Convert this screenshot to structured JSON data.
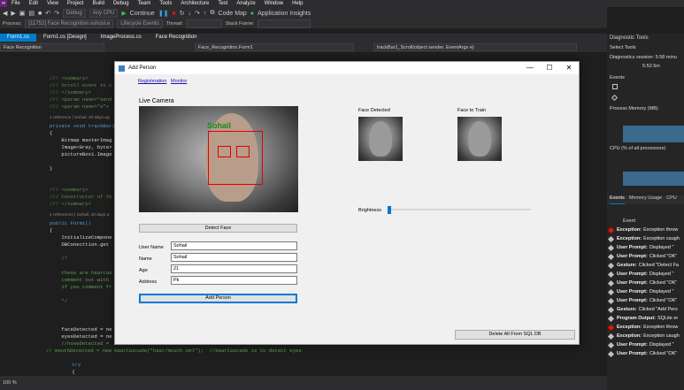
{
  "menu": {
    "items": [
      "File",
      "Edit",
      "View",
      "Project",
      "Build",
      "Debug",
      "Team",
      "Tools",
      "Architecture",
      "Test",
      "Analyze",
      "Window",
      "Help"
    ]
  },
  "toolbar": {
    "config": "Debug",
    "platform": "Any CPU",
    "continue": "Continue",
    "codemap": "Code Map",
    "insights": "Application Insights"
  },
  "debugbar": {
    "process_label": "Process:",
    "process": "[11752] Face Recognition.vshost.e",
    "lifecycle": "Lifecycle Events",
    "thread_label": "Thread:",
    "stack_label": "Stack Frame:"
  },
  "tabs": [
    {
      "label": "Form1.cs"
    },
    {
      "label": "Form1.cs [Design]"
    },
    {
      "label": "ImageProcess.cs"
    },
    {
      "label": "Face Recognition"
    }
  ],
  "navbar": {
    "project": "Face Recognition",
    "class": "Face_Recognition.Form1",
    "member": "trackBar1_Scroll(object sender, EventArgs e)"
  },
  "code": {
    "l1": "/// <summary>",
    "l2": "/// Scroll event to c",
    "l3": "/// </summary>",
    "l4": "/// <param name=\"send",
    "l5": "/// <param name=\"e\">",
    "ref1": "1 reference | Sohail, 40 days ag",
    "l6": "private void trackBar1",
    "l7": "{",
    "l8": "    Bitmap masterImag",
    "l9": "    Image<Gray, byte>",
    "l10": "    pictureBox1.Image",
    "l11": "}",
    "l12": "/// <summary>",
    "l13": "/// Constructor of th",
    "l14": "/// </summary>",
    "ref2": "2 references | Sohail, 40 days a",
    "l15": "public Form1()",
    "l16": "{",
    "l17": "    InitializeCompone",
    "l18": "    DBConecttion.get",
    "l19": "    /*",
    "l20": "    these are haarcas",
    "l21": "    comment out with",
    "l22": "    if you comment fr",
    "l23": "    */",
    "l24": "    faceDetected = ne",
    "l25": "    eyesDetected = ne",
    "l26": "    //noseDetected =",
    "l27": "// mouthDetected = new HaarCascade(\"haar/mouth.xml\");  //HaarCascade is to detect eyes",
    "l28": "    try",
    "l29": "    {"
  },
  "status": {
    "zoom": "100 %"
  },
  "dialog": {
    "title": "Add Person",
    "menu": [
      "Registeration",
      "Monitor"
    ],
    "live_camera": "Live Camera",
    "overlay_name": "Sohail",
    "face_detected": "Face Detected",
    "face_to_train": "Face to Train",
    "brightness": "Brightness",
    "brightness_level": 0.0,
    "detect_face": "Detect Face",
    "user_name_label": "User Name",
    "user_name": "Sohail",
    "name_label": "Name",
    "name": "Sohail",
    "age_label": "Age",
    "age": "21",
    "address_label": "Address",
    "address": "Pk",
    "add_person": "Add Person",
    "delete_all": "Delete All From SQL DB"
  },
  "diag": {
    "title": "Diagnostic Tools",
    "select_tools": "Select Tools",
    "session": "Diagnostics session: 5:58 minu",
    "time": "5:52.5m",
    "events": "Events",
    "memory": "Process Memory (MB)",
    "cpu": "CPU (% of all processors)",
    "tabs": [
      "Events",
      "Memory Usage",
      "CPU"
    ],
    "event_header": "Event",
    "event_rows": [
      {
        "kind": "red",
        "type": "Exception:",
        "text": "Exception throw"
      },
      {
        "kind": "gray",
        "type": "Exception:",
        "text": "Exception caugh"
      },
      {
        "kind": "gray",
        "type": "User Prompt:",
        "text": "Displayed \""
      },
      {
        "kind": "gray",
        "type": "User Prompt:",
        "text": "Clicked \"OK\""
      },
      {
        "kind": "gray",
        "type": "Gesture:",
        "text": "Clicked \"Detect Fa"
      },
      {
        "kind": "gray",
        "type": "User Prompt:",
        "text": "Displayed \""
      },
      {
        "kind": "gray",
        "type": "User Prompt:",
        "text": "Clicked \"OK\""
      },
      {
        "kind": "gray",
        "type": "User Prompt:",
        "text": "Displayed \""
      },
      {
        "kind": "gray",
        "type": "User Prompt:",
        "text": "Clicked \"OK\""
      },
      {
        "kind": "gray",
        "type": "Gesture:",
        "text": "Clicked \"Add Pers"
      },
      {
        "kind": "gray",
        "type": "Program Output:",
        "text": "SQLite er"
      },
      {
        "kind": "red",
        "type": "Exception:",
        "text": "Exception throw"
      },
      {
        "kind": "gray",
        "type": "Exception:",
        "text": "Exception caugh"
      },
      {
        "kind": "gray",
        "type": "User Prompt:",
        "text": "Displayed \""
      },
      {
        "kind": "gray",
        "type": "User Prompt:",
        "text": "Clicked \"OK\""
      }
    ]
  },
  "colors": {
    "accent": "#007acc",
    "vs_purple": "#68217a"
  }
}
